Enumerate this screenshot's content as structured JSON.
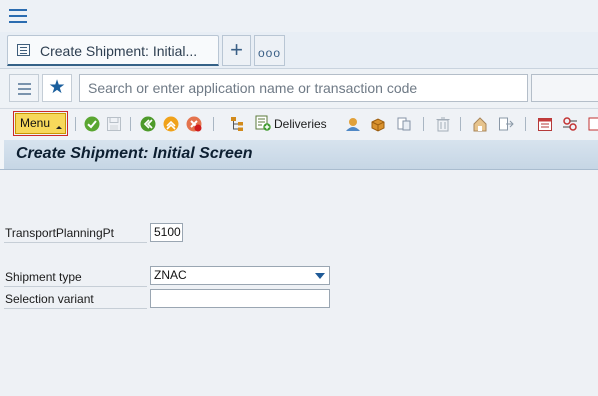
{
  "tab": {
    "title": "Create Shipment: Initial..."
  },
  "search": {
    "placeholder": "Search or enter application name or transaction code"
  },
  "toolbar": {
    "menu_label": "Menu",
    "deliveries_label": "Deliveries"
  },
  "page": {
    "title": "Create Shipment: Initial Screen"
  },
  "form": {
    "transport_planning_pt": {
      "label": "TransportPlanningPt",
      "value": "5100"
    },
    "shipment_type": {
      "label": "Shipment type",
      "value": "ZNAC"
    },
    "selection_variant": {
      "label": "Selection variant",
      "value": ""
    }
  },
  "icons": {
    "hamburger": "menu-icon",
    "tab": "document-icon",
    "add": "plus-icon",
    "more": "ellipsis-icon",
    "list": "list-icon",
    "favorite": "star-icon",
    "check": "check-icon",
    "save": "save-icon",
    "back": "back-icon",
    "exit": "exit-icon",
    "cancel": "cancel-icon",
    "hierarchy": "hierarchy-icon",
    "deliveries": "add-delivery-icon"
  },
  "colors": {
    "accent": "#346187",
    "menu_button": "#f7d85b",
    "title_band": "#c6d6e5"
  }
}
